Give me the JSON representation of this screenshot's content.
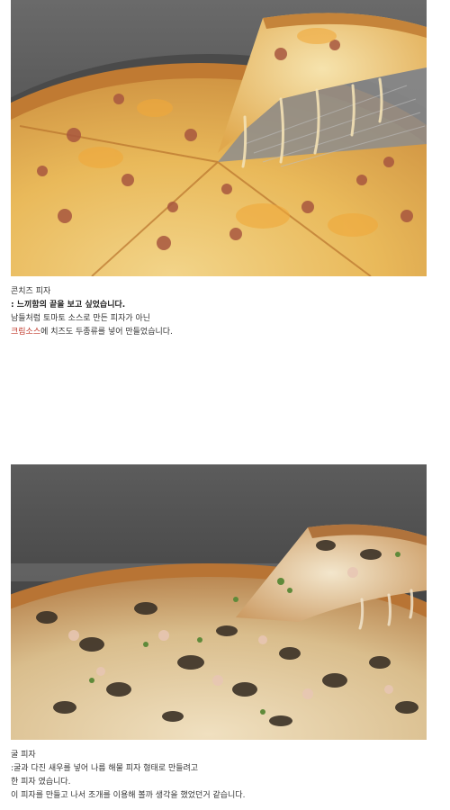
{
  "post": {
    "section1": {
      "title": "콘치즈 피자",
      "line_bold": ": 느끼함의 끝을 보고 싶었습니다.",
      "line_2": "남들처럼 토마토 소스로 만든 피자가 아닌",
      "line_3_highlight": "크림소스",
      "line_3_rest": "에 치즈도 두종류를 넣어 만들었습니다."
    },
    "section2": {
      "title": "굴 피자",
      "line_1": ":굴과 다진 새우를 넣어 나름 해물 피자 형태로 만들려고",
      "line_2": "한 피자 였습니다.",
      "line_3": "이 피자를 만들고 나서 조개를 이용해 볼까 생각을 했었던거 같습니다."
    },
    "colors": {
      "highlight": "#c0392b",
      "text": "#333333"
    }
  }
}
